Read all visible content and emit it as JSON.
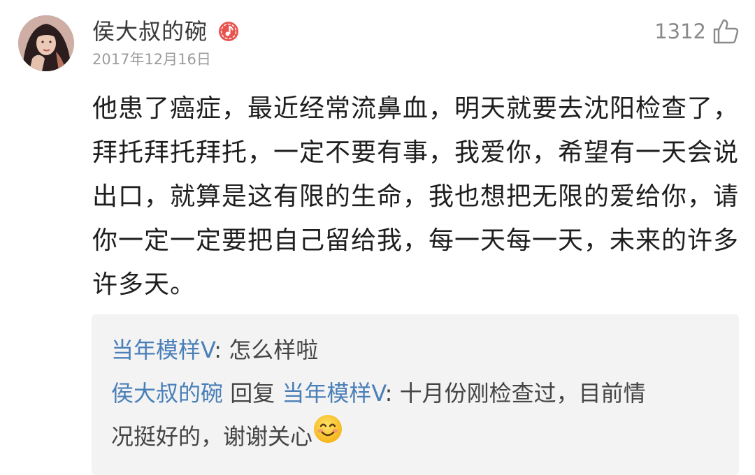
{
  "comment": {
    "author": "侯大叔的碗",
    "badge_icon": "music-note-badge-icon",
    "date": "2017年12月16日",
    "like_count": "1312",
    "like_icon": "thumbs-up-icon",
    "text": "他患了癌症，最近经常流鼻血，明天就要去沈阳检查了，拜托拜托拜托，一定不要有事，我爱你，希望有一天会说出口，就算是这有限的生命，我也想把无限的爱给你，请你一定一定要把自己留给我，每一天每一天，未来的许多许多天。"
  },
  "replies": {
    "reply1": {
      "author": "当年模样V",
      "separator": ": ",
      "text": "怎么样啦"
    },
    "reply2": {
      "author": "侯大叔的碗",
      "reply_word": " 回复 ",
      "target": "当年模样V",
      "separator": ": ",
      "text_line1": "十月份刚检查过，目前情",
      "text_line2": "况挺好的，谢谢关心",
      "emoji": "smile-emoji"
    }
  },
  "colors": {
    "link": "#4a7fb8",
    "body_text": "#1e1e1e",
    "secondary": "#9c9c9c",
    "reply_background": "#f3f3f3",
    "badge": "#e8534f"
  }
}
